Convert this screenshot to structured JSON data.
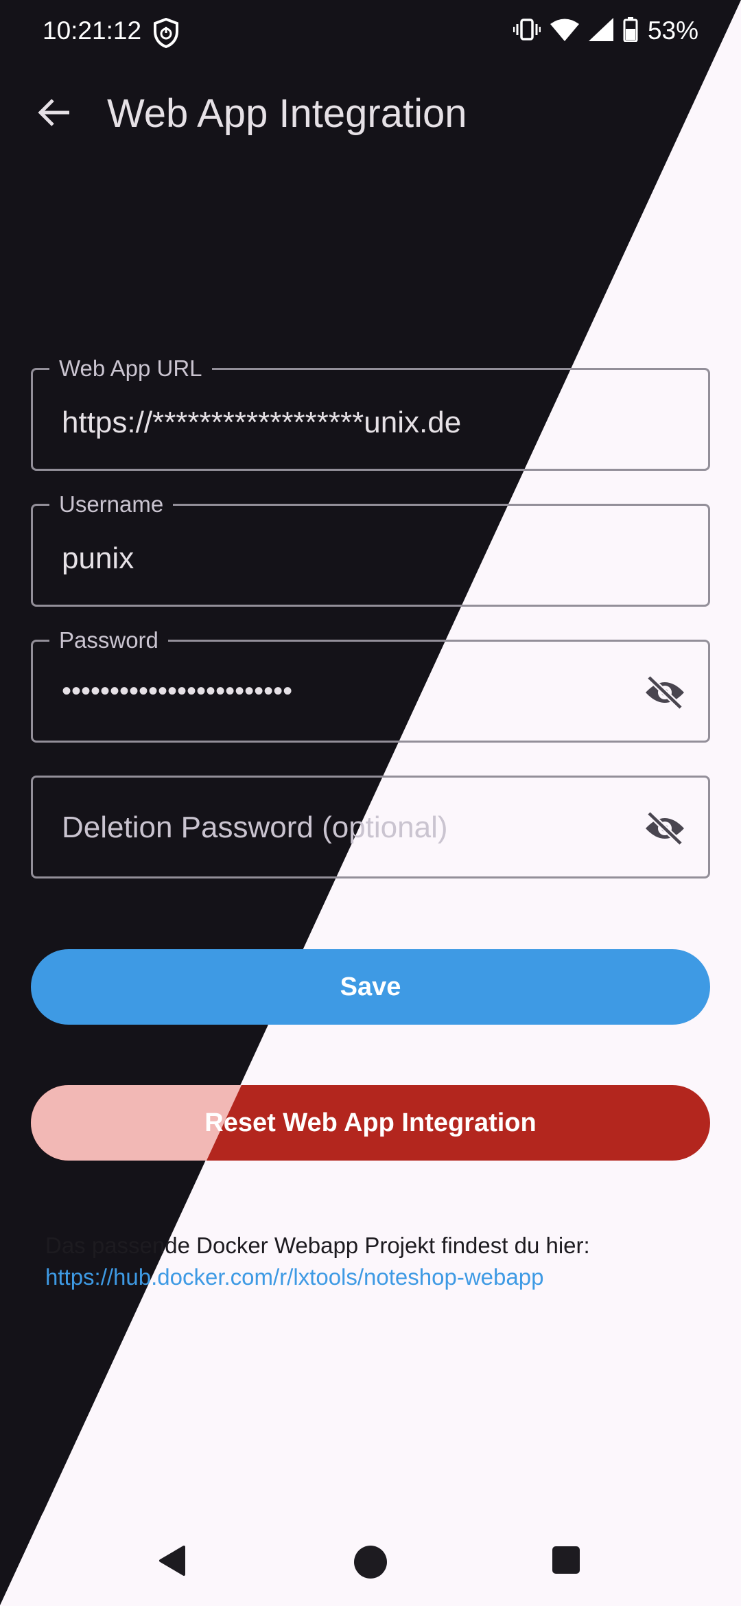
{
  "status_bar": {
    "time": "10:21:12",
    "battery": "53%"
  },
  "app_bar": {
    "title": "Web App Integration"
  },
  "form": {
    "url": {
      "label": "Web App URL",
      "value": "https://******************unix.de"
    },
    "username": {
      "label": "Username",
      "value": "punix"
    },
    "password": {
      "label": "Password",
      "value": "••••••••••••••••••••••••"
    },
    "deletion_password": {
      "placeholder": "Deletion Password (optional)"
    }
  },
  "buttons": {
    "save": "Save",
    "reset": "Reset Web App Integration"
  },
  "info": {
    "text": "Das passende Docker Webapp Projekt findest du hier:",
    "link": "https://hub.docker.com/r/lxtools/noteshop-webapp"
  },
  "colors": {
    "primary": "#3e9ae4",
    "danger": "#b3261e",
    "danger_light": "#f2b8b5",
    "dark_bg": "#141218",
    "light_bg": "#fcf7fc"
  }
}
